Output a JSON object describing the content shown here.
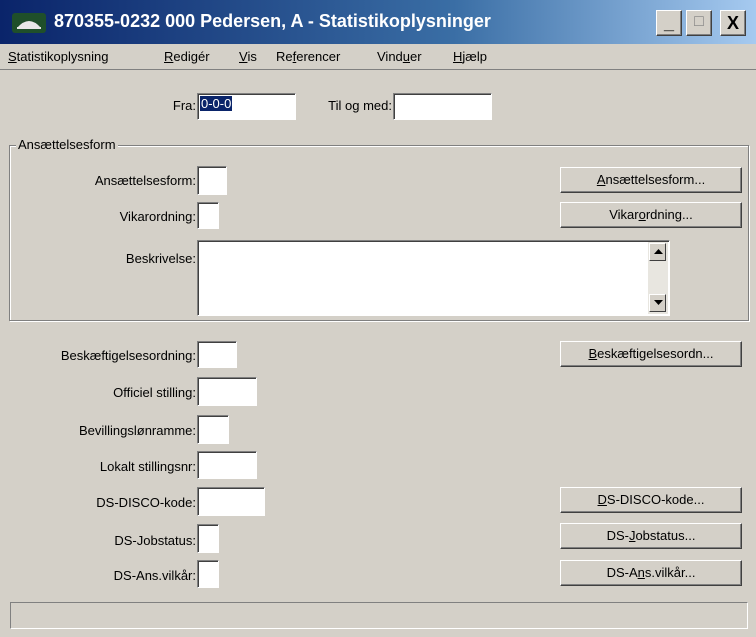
{
  "window": {
    "title": "870355-0232 000 Pedersen, A - Statistikoplysninger",
    "controls": {
      "minimize": "_",
      "maximize": "□",
      "close": "X"
    }
  },
  "menu": {
    "items": [
      {
        "pre": "",
        "ul": "S",
        "post": "tatistikoplysning"
      },
      {
        "pre": "",
        "ul": "R",
        "post": "edigér"
      },
      {
        "pre": "",
        "ul": "V",
        "post": "is"
      },
      {
        "pre": "Re",
        "ul": "f",
        "post": "erencer"
      },
      {
        "pre": "Vind",
        "ul": "u",
        "post": "er"
      },
      {
        "pre": "",
        "ul": "H",
        "post": "jælp"
      }
    ]
  },
  "period": {
    "from_label": "Fra:",
    "from_value": "0-0-0",
    "to_label": "Til og med:",
    "to_value": ""
  },
  "employment_group": {
    "title": "Ansættelsesform",
    "form_label": "Ansættelsesform:",
    "form_value": "",
    "temp_label": "Vikarordning:",
    "temp_value": "",
    "desc_label": "Beskrivelse:",
    "desc_value": "",
    "form_button": {
      "pre": "",
      "ul": "A",
      "post": "nsættelsesform..."
    },
    "temp_button": {
      "pre": "Vikar",
      "ul": "o",
      "post": "rdning..."
    }
  },
  "fields": {
    "beskaeft_label": "Beskæftigelsesordning:",
    "beskaeft_value": "",
    "officiel_label": "Officiel stilling:",
    "officiel_value": "",
    "bevilling_label": "Bevillingslønramme:",
    "bevilling_value": "",
    "lokalt_label": "Lokalt stillingsnr:",
    "lokalt_value": "",
    "disco_label": "DS-DISCO-kode:",
    "disco_value": "",
    "jobstatus_label": "DS-Jobstatus:",
    "jobstatus_value": "",
    "ansvilkar_label": "DS-Ans.vilkår:",
    "ansvilkar_value": ""
  },
  "buttons": {
    "beskaeft": {
      "pre": "",
      "ul": "B",
      "post": "eskæftigelsesordn..."
    },
    "disco": {
      "pre": "",
      "ul": "D",
      "post": "S-DISCO-kode..."
    },
    "jobstatus": {
      "pre": "DS-",
      "ul": "J",
      "post": "obstatus..."
    },
    "ansvilkar": {
      "pre": "DS-A",
      "ul": "n",
      "post": "s.vilkår..."
    }
  },
  "statusbar": {
    "text": ""
  }
}
